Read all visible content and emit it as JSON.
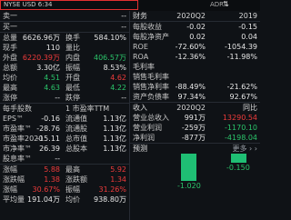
{
  "header": {
    "exchange_line": "NYSE  USD  6:34",
    "adr": "ADR",
    "adr_arrow": "⇅"
  },
  "left_panel": {
    "bid_ask_rows": [
      {
        "label": "卖一",
        "value": "--"
      },
      {
        "label": "买一",
        "value": "--"
      }
    ],
    "stats": [
      {
        "l1": "总量",
        "v1": "6626.96万",
        "c1": "white",
        "l2": "换手",
        "v2": "584.10%",
        "c2": "white"
      },
      {
        "l1": "现手",
        "v1": "110",
        "c1": "white",
        "l2": "量比",
        "v2": "",
        "c2": "white"
      },
      {
        "l1": "外盘",
        "v1": "6220.39万",
        "c1": "red",
        "l2": "内盘",
        "v2": "406.57万",
        "c2": "green"
      },
      {
        "l1": "总额",
        "v1": "3.30亿",
        "c1": "white",
        "l2": "振幅",
        "v2": "8.53%",
        "c2": "white"
      },
      {
        "l1": "均价",
        "v1": "4.51",
        "c1": "green",
        "l2": "开盘",
        "v2": "4.62",
        "c2": "red"
      },
      {
        "l1": "最高",
        "v1": "4.63",
        "c1": "green",
        "l2": "最低",
        "v2": "4.22",
        "c2": "green"
      },
      {
        "l1": "涨停",
        "v1": "--",
        "c1": "white",
        "l2": "跌停",
        "v2": "--",
        "c2": "white"
      }
    ],
    "share_stats": [
      {
        "l1": "每手股数",
        "v1": "",
        "c1": "white",
        "l2": "1 市盈率TTM",
        "v2": "",
        "c2": "white"
      },
      {
        "l1": "EPS™",
        "v1": "-0.16",
        "c1": "white",
        "l2": "流通值",
        "v2": "1.13亿",
        "c2": "white"
      },
      {
        "l1": "市盈率™",
        "v1": "-28.76",
        "c1": "white",
        "l2": "流通股",
        "v2": "1.13亿",
        "c2": "white"
      },
      {
        "l1": "市盈率2020",
        "v1": "-15.11",
        "c1": "white",
        "l2": "总市值",
        "v2": "1.13亿",
        "c2": "white"
      },
      {
        "l1": "市净率™",
        "v1": "26.39",
        "c1": "white",
        "l2": "总股本",
        "v2": "1.13亿",
        "c2": "white"
      },
      {
        "l1": "股息率™",
        "v1": "--",
        "c1": "white",
        "l2": "",
        "v2": "",
        "c2": "white"
      }
    ],
    "period_stats": [
      {
        "l1": "涨幅",
        "v1": "5.88",
        "c1": "red",
        "l2": "最高",
        "v2": "5.92",
        "c2": "red"
      },
      {
        "l1": "涨跌幅",
        "v1": "1.38",
        "c1": "red",
        "l2": "涨跌额",
        "v2": "1.34",
        "c2": "red"
      },
      {
        "l1": "涨幅",
        "v1": "30.67%",
        "c1": "red",
        "l2": "振幅",
        "v2": "31.26%",
        "c2": "red"
      },
      {
        "l1": "平均量",
        "v1": "191.04万",
        "c1": "white",
        "l2": "均价",
        "v2": "938.80万",
        "c2": "white"
      }
    ]
  },
  "right_panel": {
    "fin_header": {
      "title": "财务",
      "col1": "2020Q2",
      "col2": "2019"
    },
    "fin_rows": [
      {
        "label": "每股收益",
        "c1": "-0.02",
        "c2": "-0.15"
      },
      {
        "label": "每股净资产",
        "c1": "0.02",
        "c2": "0.04"
      },
      {
        "label": "ROE",
        "c1": "-72.60%",
        "c2": "-1054.39"
      },
      {
        "label": "ROA",
        "c1": "-12.36%",
        "c2": "-11.98%"
      },
      {
        "label": "毛利率",
        "c1": "",
        "c2": ""
      },
      {
        "label": "销售毛利率",
        "c1": "",
        "c2": ""
      },
      {
        "label": "销售净利率",
        "c1": "-88.49%",
        "c2": "-21.62%"
      },
      {
        "label": "资产负债率",
        "c1": "97.34%",
        "c2": "92.67%"
      }
    ],
    "report_header": {
      "title": "收入",
      "col1": "2020Q2",
      "col2": "同比"
    },
    "report_rows": [
      {
        "label": "营业总收入",
        "c1": "991万",
        "c1c": "white",
        "c2": "13290.54",
        "c2c": "red"
      },
      {
        "label": "营业利润",
        "c1": "-259万",
        "c1c": "white",
        "c2": "-1170.10",
        "c2c": "green"
      },
      {
        "label": "净利润",
        "c1": "-877万",
        "c1c": "white",
        "c2": "-4198.04",
        "c2c": "green"
      }
    ],
    "forecast": {
      "title": "预测",
      "more": "更多 › ›"
    },
    "bar_labels": [
      "-1.020",
      "-0.150"
    ]
  }
}
